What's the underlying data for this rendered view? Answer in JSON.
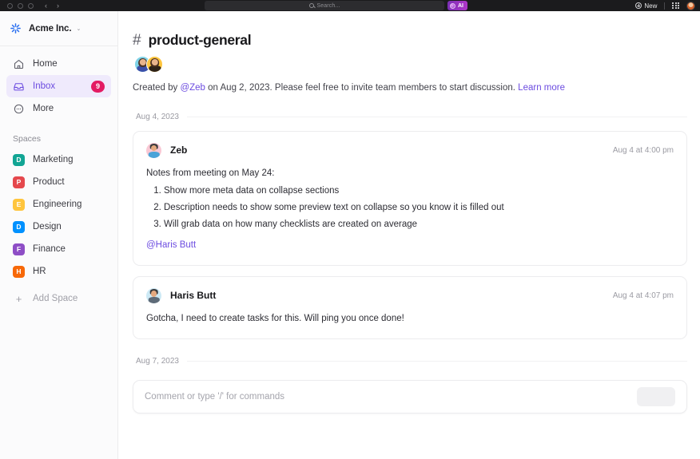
{
  "topbar": {
    "search_placeholder": "Search...",
    "ai_label": "AI",
    "new_label": "New",
    "window_dots": 3,
    "back_glyph": "‹",
    "forward_glyph": "›"
  },
  "sidebar": {
    "workspace_name": "Acme Inc.",
    "workspace_caret": "⌄",
    "nav": [
      {
        "label": "Home",
        "icon": "home-icon",
        "active": false,
        "badge": ""
      },
      {
        "label": "Inbox",
        "icon": "inbox-icon",
        "active": true,
        "badge": "9"
      },
      {
        "label": "More",
        "icon": "more-circle-icon",
        "active": false,
        "badge": ""
      }
    ],
    "spaces_title": "Spaces",
    "spaces": [
      {
        "label": "Marketing",
        "letter": "D",
        "color": "#12A594"
      },
      {
        "label": "Product",
        "letter": "P",
        "color": "#E5484D"
      },
      {
        "label": "Engineering",
        "letter": "E",
        "color": "#FFC53D"
      },
      {
        "label": "Design",
        "letter": "D",
        "color": "#0091FF"
      },
      {
        "label": "Finance",
        "letter": "F",
        "color": "#8E4EC6"
      },
      {
        "label": "HR",
        "letter": "H",
        "color": "#F76808"
      }
    ],
    "add_space_label": "Add Space",
    "add_space_plus": "+"
  },
  "main": {
    "hash": "#",
    "title": "product-general",
    "members": [
      {
        "name": "member-1",
        "bg": "#7FD3E8",
        "hair": "#4a3326",
        "shirt": "#3b4fa8"
      },
      {
        "name": "member-2",
        "bg": "#FFC53D",
        "hair": "#4a2f20",
        "shirt": "#2d2218"
      }
    ],
    "description": {
      "pre": "Created by ",
      "mention": "@Zeb",
      "mid": " on Aug 2, 2023. Please feel free to invite team members to start discussion. ",
      "link": "Learn more"
    },
    "date_separators": {
      "first": "Aug 4, 2023",
      "second": "Aug 7, 2023"
    },
    "messages": [
      {
        "author": "Zeb",
        "time": "Aug 4 at 4:00 pm",
        "avatar_bg": "#F9C8D4",
        "avatar_shirt": "#4aa3d8",
        "intro": "Notes from meeting on May 24:",
        "list": [
          "Show more meta data on collapse sections",
          "Description needs to show some preview text on collapse so you know it is filled out",
          "Will grab data on how many checklists are created on average"
        ],
        "mention": "@Haris Butt"
      },
      {
        "author": "Haris Butt",
        "time": "Aug 4 at 4:07 pm",
        "avatar_bg": "#CDE9F5",
        "avatar_shirt": "#5e6b78",
        "text": "Gotcha, I need to create tasks for this. Will ping you once done!"
      }
    ],
    "composer_placeholder": "Comment or type '/' for commands"
  },
  "colors": {
    "accent": "#6c4ce0",
    "badge": "#e31b63",
    "topbar": "#1b1b1d",
    "sidebar_bg": "#fbfbfc"
  }
}
